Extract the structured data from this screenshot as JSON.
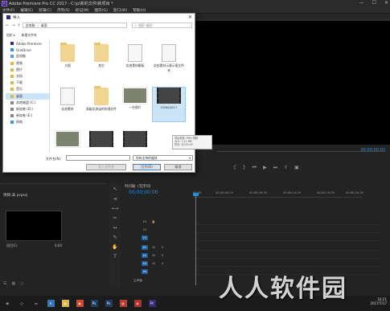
{
  "app": {
    "title": "Adobe Premiere Pro CC 2017 - C:\\p\\新的文件\\新项目 *",
    "menu": [
      "文件(F)",
      "编辑(E)",
      "剪辑(C)",
      "序列(S)",
      "标记(M)",
      "图形(G)",
      "窗口(W)",
      "帮助(H)"
    ],
    "window_controls": [
      "—",
      "☐",
      "✕"
    ]
  },
  "program_monitor": {
    "timecode": "00;00;00;00",
    "timecode2": "00;00;00;00"
  },
  "project_panel": {
    "title": "项目:未 prproj",
    "clip_name": "项目(1)",
    "clip_time": "0:00"
  },
  "timeline": {
    "tab": "时间轴: (无序列)",
    "timecode": "00;00;00;00",
    "ruler": [
      "00;00",
      "00;00;04;29",
      "00;00;09;29",
      "00;00;14;29",
      "00;00;19;29",
      "00;00;24;29"
    ],
    "video_tracks": [
      "V3",
      "V2",
      "V1"
    ],
    "audio_tracks": [
      "A1",
      "A2",
      "A3",
      "A4"
    ],
    "master": "主声道"
  },
  "dialog": {
    "title": "导入",
    "close": "✕",
    "path": [
      "此电脑",
      "桌面"
    ],
    "search_placeholder": "搜索\"桌面\"",
    "toolbar": [
      "组织 ▾",
      "新建文件夹"
    ],
    "tree": [
      {
        "label": "Adobe Premiere",
        "icon": "premiere-icon"
      },
      {
        "label": "OneDrive",
        "icon": "cloud-icon"
      },
      {
        "label": "此电脑",
        "icon": "computer-icon"
      },
      {
        "label": "视频",
        "icon": "video-folder-icon"
      },
      {
        "label": "图片",
        "icon": "pictures-folder-icon"
      },
      {
        "label": "文档",
        "icon": "documents-folder-icon"
      },
      {
        "label": "下载",
        "icon": "download-folder-icon"
      },
      {
        "label": "音乐",
        "icon": "music-folder-icon"
      },
      {
        "label": "桌面",
        "icon": "desktop-folder-icon",
        "selected": true
      },
      {
        "label": "本地磁盘 (C:)",
        "icon": "drive-icon"
      },
      {
        "label": "新加卷 (D:)",
        "icon": "drive-icon"
      },
      {
        "label": "新加卷 (E:)",
        "icon": "drive-icon"
      },
      {
        "label": "网络",
        "icon": "network-icon"
      }
    ],
    "files": [
      {
        "label": "大图",
        "kind": "folder"
      },
      {
        "label": "其它",
        "kind": "folder"
      },
      {
        "label": "实拍素材模板",
        "kind": "doc"
      },
      {
        "label": "实拍素材示意示意文件夹",
        "kind": "doc"
      },
      {
        "label": "实拍素材",
        "kind": "doc"
      },
      {
        "label": "高级化渲染的的理文件",
        "kind": "folder"
      },
      {
        "label": "一些图片",
        "kind": "photo"
      },
      {
        "label": "OCNA2017",
        "kind": "video",
        "selected": true
      },
      {
        "label": "",
        "kind": "photo"
      },
      {
        "label": "",
        "kind": "video"
      },
      {
        "label": "",
        "kind": "video"
      }
    ],
    "tooltip": [
      "项目类型: MP4 视频",
      "大小: 1.12 MB",
      "时长: 00:00:05"
    ],
    "filename_label": "文件名(N):",
    "filetype": "所有支持的媒体",
    "buttons": {
      "import_folder": "导入文件夹",
      "open": "打开(O)",
      "cancel": "取消"
    }
  },
  "taskbar": {
    "icons": [
      {
        "icon": "windows-start-icon",
        "glyph": "⊞",
        "color": ""
      },
      {
        "icon": "search-icon",
        "glyph": "○",
        "color": ""
      },
      {
        "icon": "task-view-icon",
        "glyph": "▭",
        "color": ""
      },
      {
        "icon": "edge-icon",
        "glyph": "e",
        "color": "#3277bc"
      },
      {
        "icon": "explorer-icon",
        "glyph": "▤",
        "color": "#e0b542"
      },
      {
        "icon": "store-icon",
        "glyph": "◉",
        "color": "#d9462a"
      },
      {
        "icon": "photoshop-icon",
        "glyph": "Ps",
        "color": "#1d3d66"
      },
      {
        "icon": "photoshop-icon-2",
        "glyph": "Ps",
        "color": "#1d3d66"
      },
      {
        "icon": "app-icon",
        "glyph": "◍",
        "color": "#c23a2b"
      },
      {
        "icon": "app-icon-2",
        "glyph": "◍",
        "color": "#b5302b"
      },
      {
        "icon": "premiere-icon",
        "glyph": "Pr",
        "color": "#3b2a7a"
      }
    ],
    "time": "16:21",
    "date": "2017/7/17"
  },
  "watermark": "人人软件园",
  "colors": {
    "accent": "#2b8bd4",
    "track_blue": "#1d5f9c"
  }
}
